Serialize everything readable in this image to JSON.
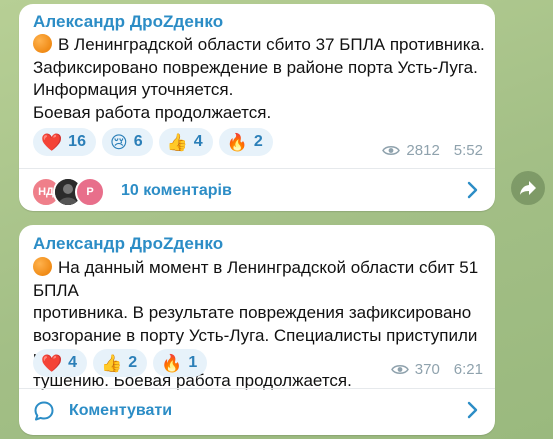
{
  "posts": [
    {
      "author": "Александр ДроZденко",
      "lines": [
        "В Ленинградской области сбито 37 БПЛА противника.",
        "Зафиксировано повреждение в районе порта Усть-Луга.",
        "Информация уточняется.",
        "Боевая работа продолжается."
      ],
      "reactions": [
        {
          "icon": "heart-icon",
          "emoji": "❤️",
          "count": "16"
        },
        {
          "icon": "crying-face-icon",
          "emoji": "😢",
          "count": "6"
        },
        {
          "icon": "thumbs-up-icon",
          "emoji": "👍",
          "count": "4"
        },
        {
          "icon": "fire-icon",
          "emoji": "🔥",
          "count": "2"
        }
      ],
      "views": "2812",
      "time": "5:52",
      "comment_avatars": [
        "НД",
        "",
        "Р"
      ],
      "comments_label": "10 коментарів"
    },
    {
      "author": "Александр ДроZденко",
      "lines": [
        "На данный момент в Ленинградской области сбит 51 БПЛА",
        "противника. В результате повреждения зафиксировано",
        "возгорание в порту Усть-Луга. Специалисты приступили к",
        "тушению. Боевая работа продолжается."
      ],
      "reactions": [
        {
          "icon": "heart-icon",
          "emoji": "❤️",
          "count": "4"
        },
        {
          "icon": "thumbs-up-icon",
          "emoji": "👍",
          "count": "2"
        },
        {
          "icon": "fire-icon",
          "emoji": "🔥",
          "count": "1"
        }
      ],
      "views": "370",
      "time": "6:21",
      "comments_label": "Коментувати"
    }
  ],
  "colors": {
    "accent": "#2c8dc6",
    "chip_bg": "#e7f2fa",
    "meta": "#8fa2ad"
  }
}
